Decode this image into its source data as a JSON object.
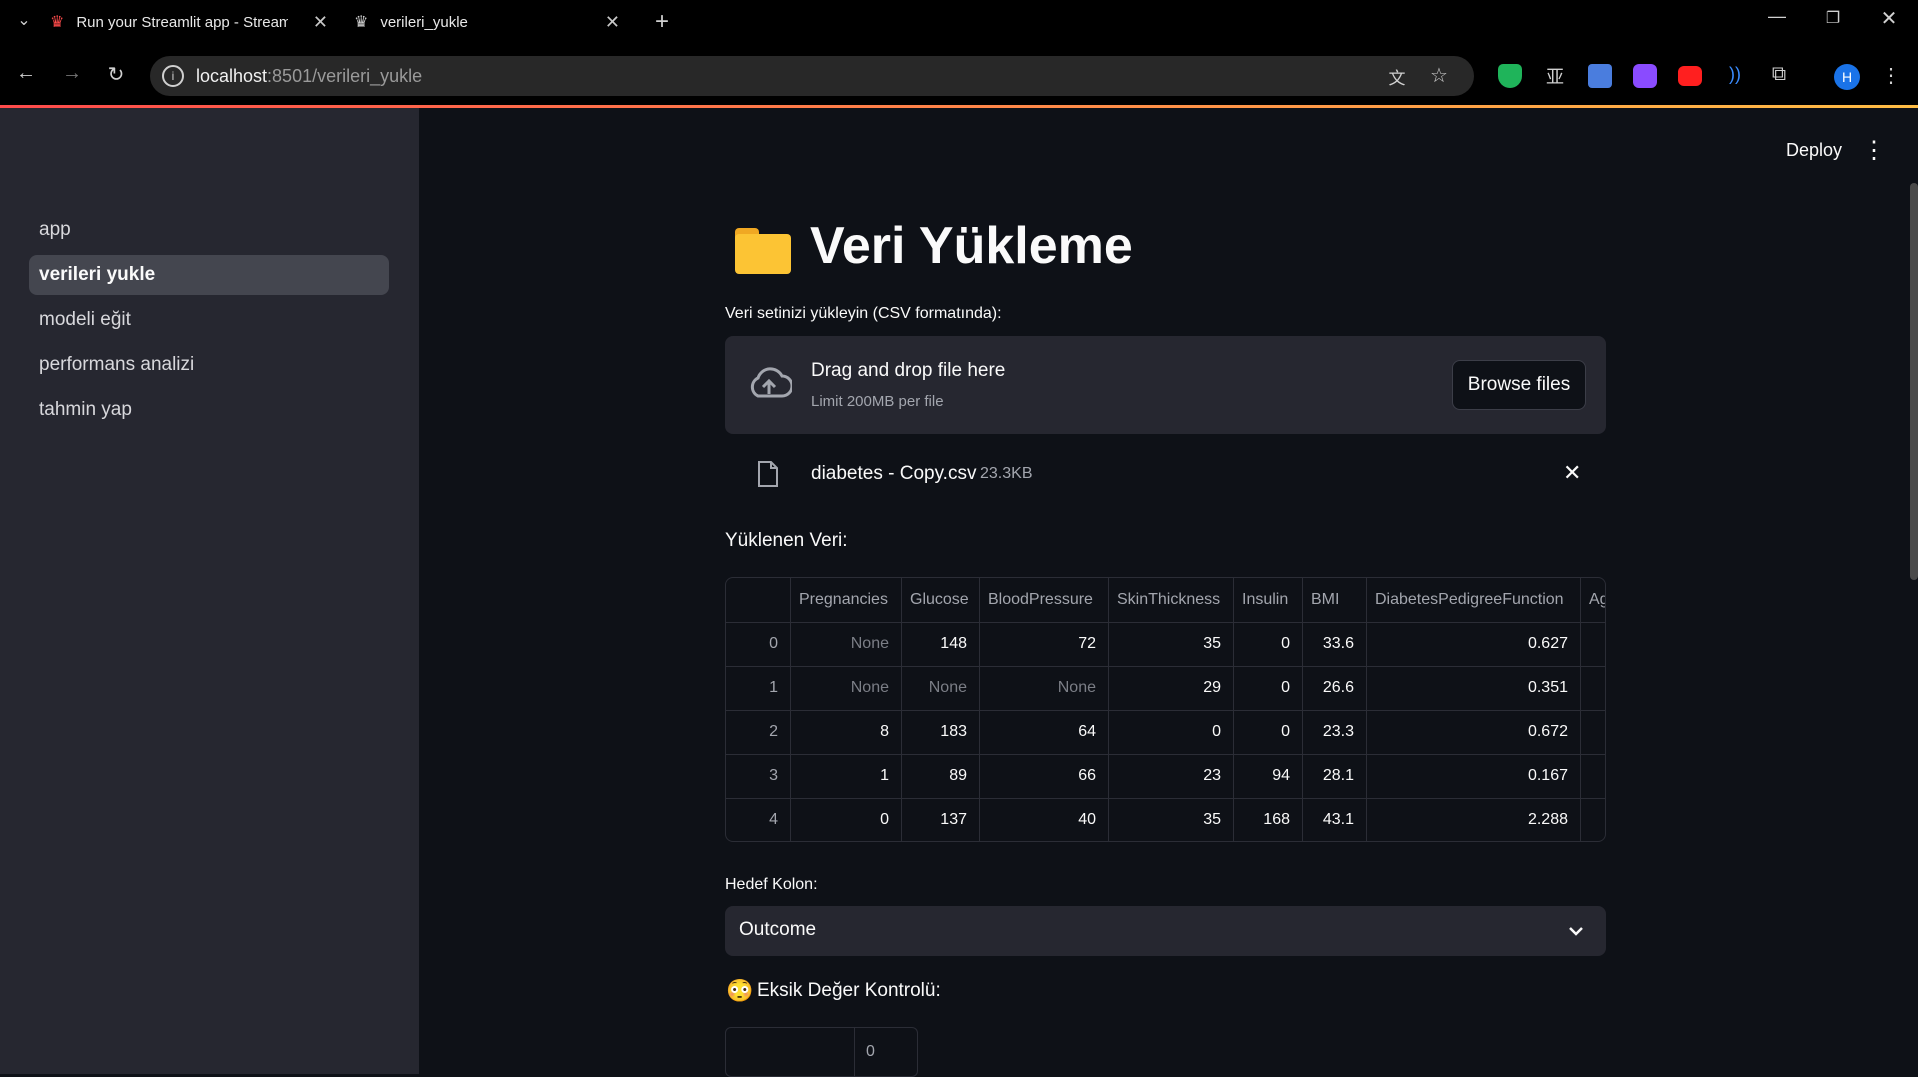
{
  "browser": {
    "tabs": [
      {
        "label": "Run your Streamlit app - Streamlit"
      },
      {
        "label": "verileri_yukle"
      }
    ],
    "url_host": "localhost",
    "url_path": ":8501/verileri_yukle",
    "profile_initial": "H"
  },
  "header": {
    "deploy_label": "Deploy"
  },
  "sidebar": {
    "items": [
      {
        "label": "app"
      },
      {
        "label": "verileri yukle"
      },
      {
        "label": "modeli eğit"
      },
      {
        "label": "performans analizi"
      },
      {
        "label": "tahmin yap"
      }
    ]
  },
  "page": {
    "title": "Veri Yükleme",
    "uploader_label": "Veri setinizi yükleyin (CSV formatında):",
    "dropzone_title": "Drag and drop file here",
    "dropzone_limit": "Limit 200MB per file",
    "browse_label": "Browse files",
    "file_name": "diabetes - Copy.csv",
    "file_size": "23.3KB",
    "loaded_heading": "Yüklenen Veri:",
    "target_label": "Hedef Kolon:",
    "target_value": "Outcome",
    "missing_heading": "Eksik Değer Kontrolü:",
    "missing_value": "0"
  },
  "table": {
    "columns": [
      "",
      "Pregnancies",
      "Glucose",
      "BloodPressure",
      "SkinThickness",
      "Insulin",
      "BMI",
      "DiabetesPedigreeFunction",
      "Ag"
    ],
    "rows": [
      [
        "0",
        "None",
        "148",
        "72",
        "35",
        "0",
        "33.6",
        "0.627"
      ],
      [
        "1",
        "None",
        "None",
        "None",
        "29",
        "0",
        "26.6",
        "0.351"
      ],
      [
        "2",
        "8",
        "183",
        "64",
        "0",
        "0",
        "23.3",
        "0.672"
      ],
      [
        "3",
        "1",
        "89",
        "66",
        "23",
        "94",
        "28.1",
        "0.167"
      ],
      [
        "4",
        "0",
        "137",
        "40",
        "35",
        "168",
        "43.1",
        "2.288"
      ]
    ]
  },
  "colors": {
    "background": "#0e1117",
    "sidebar": "#262730",
    "accent_red": "#ff4b4b",
    "accent_yellow": "#ffbd45"
  }
}
